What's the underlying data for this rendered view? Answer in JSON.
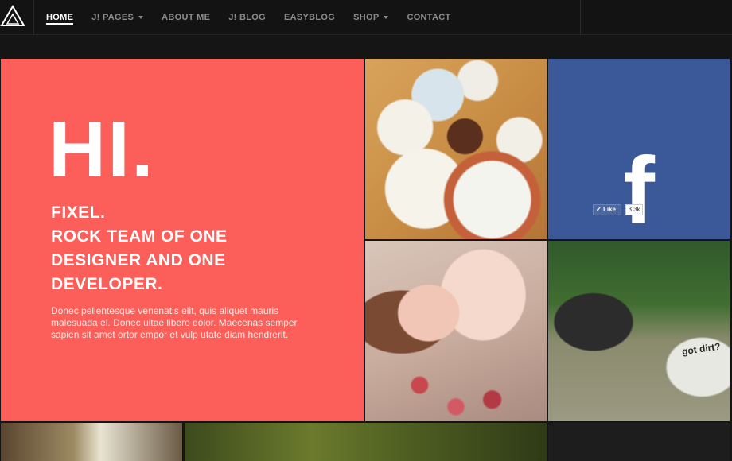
{
  "nav": {
    "logo_icon": "triangle-logo-icon",
    "items": [
      {
        "label": "HOME",
        "active": true,
        "has_caret": false
      },
      {
        "label": "J! PAGES",
        "active": false,
        "has_caret": true
      },
      {
        "label": "ABOUT ME",
        "active": false,
        "has_caret": false
      },
      {
        "label": "J! BLOG",
        "active": false,
        "has_caret": false
      },
      {
        "label": "EASYBLOG",
        "active": false,
        "has_caret": false
      },
      {
        "label": "SHOP",
        "active": false,
        "has_caret": true
      },
      {
        "label": "CONTACT",
        "active": false,
        "has_caret": false
      }
    ]
  },
  "hero": {
    "title": "HI.",
    "subtitle_lines": [
      "FIXEL.",
      "ROCK TEAM OF ONE",
      "DESIGNER AND ONE",
      "DEVELOPER."
    ],
    "body": "Donec pellentesque venenatis elit, quis aliquet mauris malesuada el. Donec uitae libero dolor. Maecenas semper sapien sit amet ortor empor et vulp utate diam hendrerit.",
    "background": "#fc5f5a"
  },
  "facebook": {
    "icon": "facebook-f-icon",
    "glyph": "f",
    "like_label": "Like",
    "like_count": "3.3k",
    "background": "#3b5998"
  },
  "photo_texts": {
    "shirt": "got dirt?"
  },
  "colors": {
    "nav_bg": "#131313",
    "nav_text": "#8d8d8d",
    "nav_active": "#ffffff",
    "page_bg": "#151515"
  }
}
